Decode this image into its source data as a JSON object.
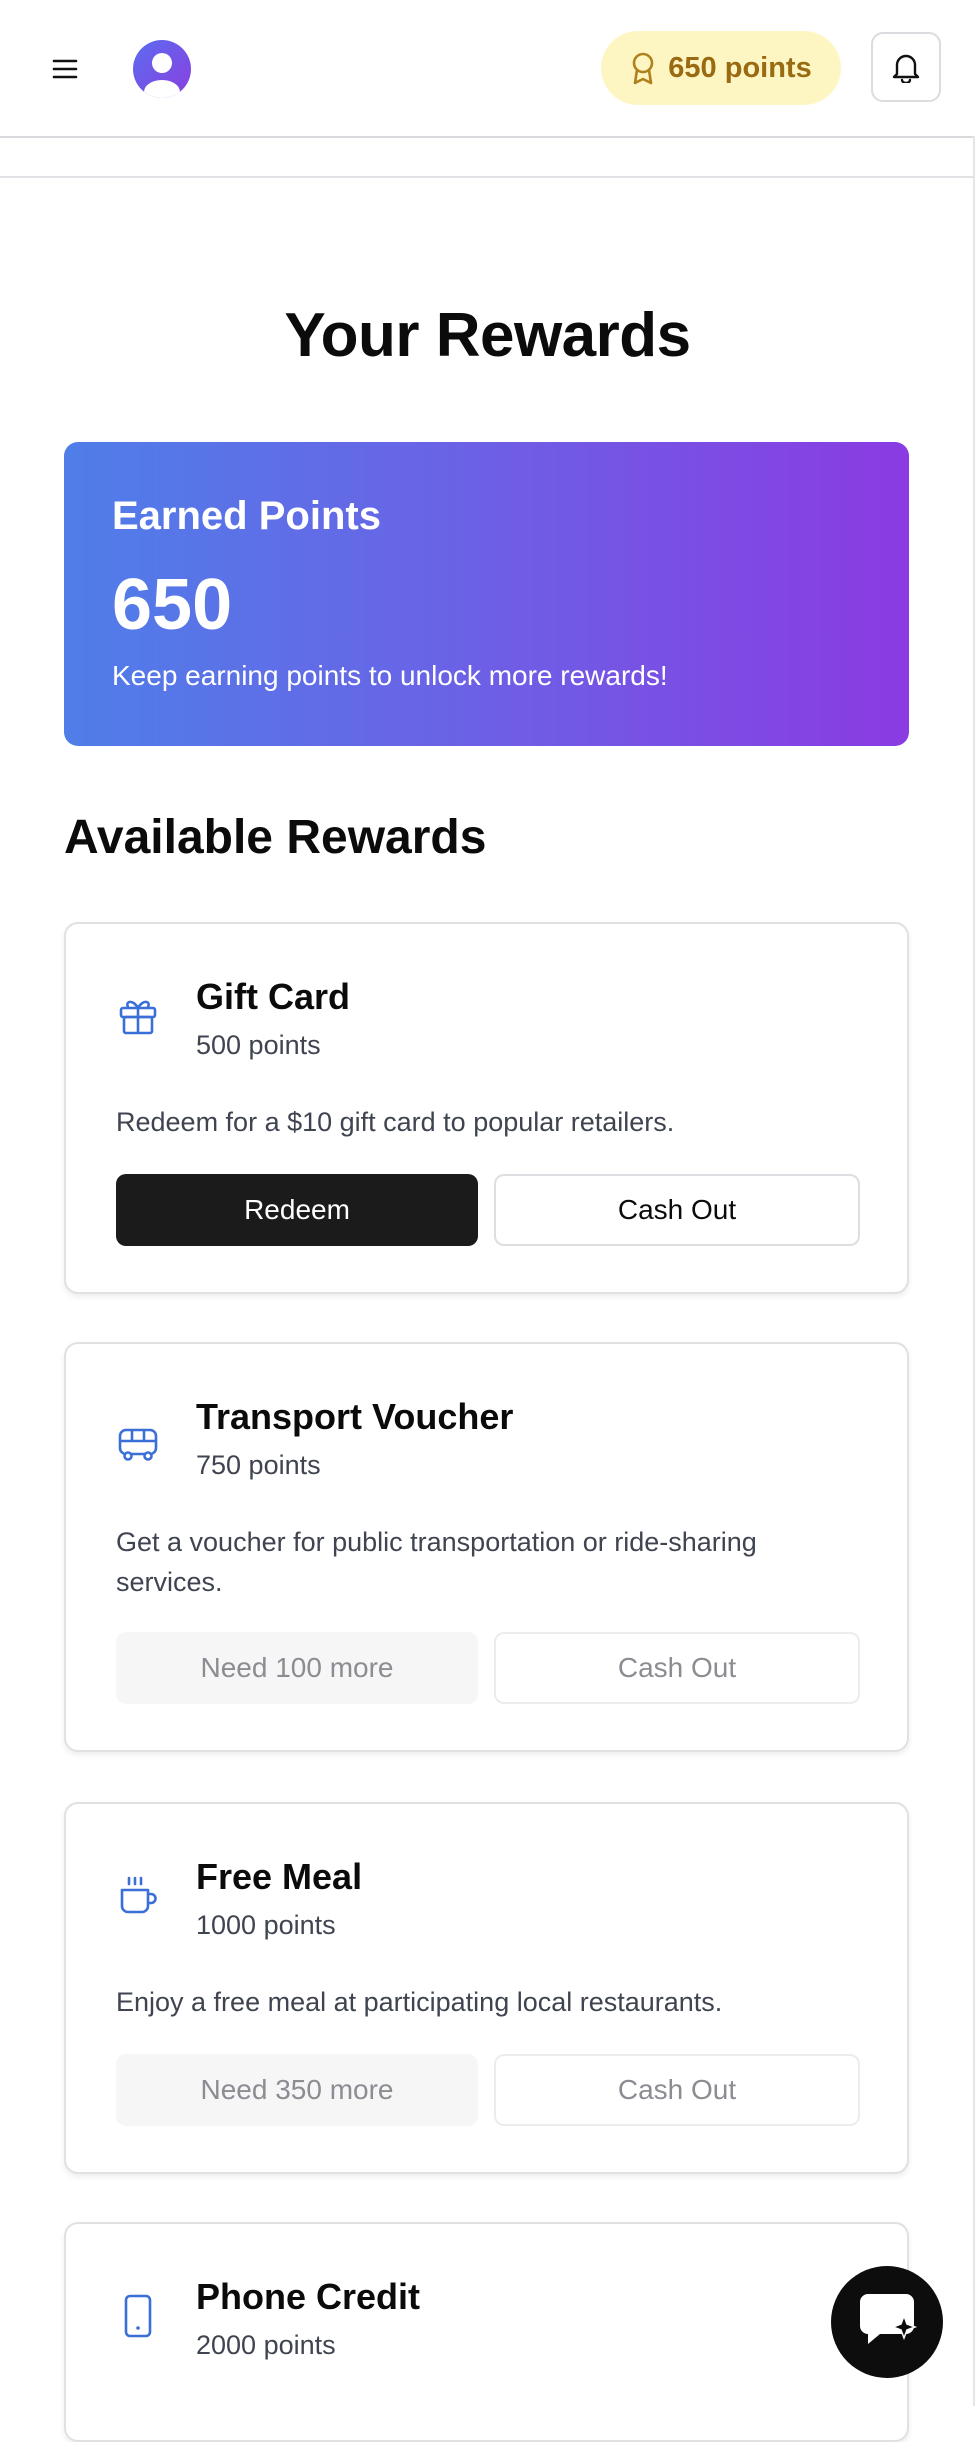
{
  "header": {
    "menu_icon": "menu-icon",
    "avatar_icon": "user-avatar",
    "points_badge": {
      "icon": "award-icon",
      "label": "650 points"
    },
    "notification_icon": "bell-icon"
  },
  "page": {
    "title": "Your Rewards"
  },
  "earned": {
    "label": "Earned Points",
    "value": "650",
    "message": "Keep earning points to unlock more rewards!"
  },
  "available": {
    "title": "Available Rewards",
    "rewards": [
      {
        "icon": "gift-icon",
        "name": "Gift Card",
        "cost": "500 points",
        "description": "Redeem for a $10 gift card to popular retailers.",
        "primary_label": "Redeem",
        "cash_label": "Cash Out",
        "enabled": true
      },
      {
        "icon": "bus-icon",
        "name": "Transport Voucher",
        "cost": "750 points",
        "description": "Get a voucher for public transportation or ride-sharing services.",
        "primary_label": "Need 100 more",
        "cash_label": "Cash Out",
        "enabled": false
      },
      {
        "icon": "coffee-icon",
        "name": "Free Meal",
        "cost": "1000 points",
        "description": "Enjoy a free meal at participating local restaurants.",
        "primary_label": "Need 350 more",
        "cash_label": "Cash Out",
        "enabled": false
      },
      {
        "icon": "phone-icon",
        "name": "Phone Credit",
        "cost": "2000 points"
      }
    ]
  },
  "chat": {
    "icon": "chat-sparkle-icon"
  },
  "colors": {
    "accent": "#4f7ee8",
    "gradient_end": "#8a3be2",
    "badge_bg": "#fdf6c3",
    "badge_text": "#9a6a12",
    "icon_blue": "#3b6fd8"
  }
}
